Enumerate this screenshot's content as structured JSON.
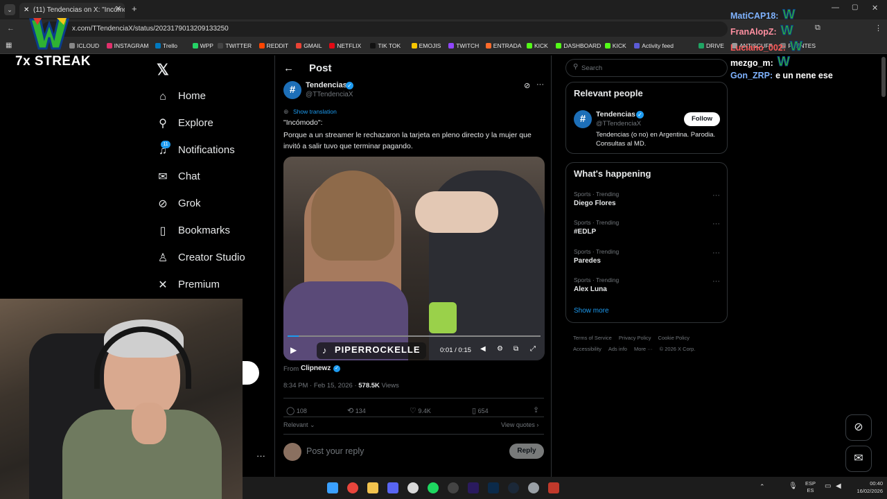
{
  "browser": {
    "tab_title": "(11) Tendencias on X: \"Incómo",
    "url": "x.com/TTendenciaX/status/2023179013209133250",
    "bookmarks": [
      "ICLOUD",
      "INSTAGRAM",
      "Trello",
      "WPP",
      "TWITTER",
      "REDDIT",
      "GMAIL",
      "NETFLIX",
      "TIK TOK",
      "EMOJIS",
      "TWITCH",
      "ENTRADA",
      "KICK",
      "DASHBOARD",
      "KICK",
      "Activity feed",
      "DRIVE",
      "ANTISCUFF",
      "FUENTES"
    ]
  },
  "overlay": {
    "streak": "7x STREAK",
    "chat": [
      {
        "user": "MatiCAP18:",
        "msg": "",
        "color": "#7fb3ff"
      },
      {
        "user": "FranAlopZ:",
        "msg": "",
        "color": "#ff8fa0"
      },
      {
        "user": "Luciano_002:",
        "msg": "",
        "color": "#ff5a5a"
      },
      {
        "user": "mezgo_m:",
        "msg": "",
        "color": "#ffffff"
      },
      {
        "user": "Gon_ZRP:",
        "msg": "e un nene ese",
        "color": "#7fb3ff"
      }
    ]
  },
  "nav": {
    "items": [
      {
        "label": "Home",
        "icon": "home-icon",
        "glyph": "⌂"
      },
      {
        "label": "Explore",
        "icon": "search-icon",
        "glyph": "⚲"
      },
      {
        "label": "Notifications",
        "icon": "bell-icon",
        "glyph": "♫",
        "badge": "11"
      },
      {
        "label": "Chat",
        "icon": "mail-icon",
        "glyph": "✉"
      },
      {
        "label": "Grok",
        "icon": "grok-icon",
        "glyph": "⊘"
      },
      {
        "label": "Bookmarks",
        "icon": "bookmark-icon",
        "glyph": "▯"
      },
      {
        "label": "Creator Studio",
        "icon": "creator-icon",
        "glyph": "♙"
      },
      {
        "label": "Premium",
        "icon": "x-logo-icon",
        "glyph": "✕"
      }
    ]
  },
  "post": {
    "header": "Post",
    "author": "Tendencias",
    "handle": "@TTendenciaX",
    "show_translation": "Show translation",
    "text_title": "\"Incómodo\":",
    "text_body": "Porque a un streamer le rechazaron la tarjeta en pleno directo y la mujer que invitó a salir tuvo que terminar pagando.",
    "video_time": "0:01 / 0:15",
    "video_watermark": "PIPERROCKELLE",
    "from_label": "From",
    "from_author": "Clipnewz",
    "timestamp": "8:34 PM · Feb 15, 2026 · ",
    "views_count": "578.5K",
    "views_label": "Views",
    "stats": {
      "replies": "108",
      "reposts": "134",
      "likes": "9.4K",
      "bookmarks": "654"
    },
    "relevant": "Relevant",
    "view_quotes": "View quotes",
    "reply_placeholder": "Post your reply",
    "reply_button": "Reply"
  },
  "sidebar": {
    "search_placeholder": "Search",
    "relevant_title": "Relevant people",
    "person": {
      "name": "Tendencias",
      "handle": "@TTendenciaX",
      "bio": "Tendencias (o no) en Argentina. Parodia. Consultas al MD.",
      "follow": "Follow"
    },
    "happening_title": "What's happening",
    "trends": [
      {
        "category": "Sports · Trending",
        "name": "Diego Flores"
      },
      {
        "category": "Sports · Trending",
        "name": "#EDLP"
      },
      {
        "category": "Sports · Trending",
        "name": "Paredes"
      },
      {
        "category": "Sports · Trending",
        "name": "Alex Luna"
      }
    ],
    "show_more": "Show more",
    "footer": [
      "Terms of Service",
      "Privacy Policy",
      "Cookie Policy",
      "Accessibility",
      "Ads info",
      "More ···",
      "© 2026 X Corp."
    ]
  },
  "taskbar": {
    "lang": "ESP",
    "lang2": "ES",
    "time": "00:40",
    "date": "16/02/2026"
  },
  "colors": {
    "accent": "#1d9bf0",
    "background": "#000000",
    "border": "#2f3336",
    "muted": "#71767b"
  }
}
